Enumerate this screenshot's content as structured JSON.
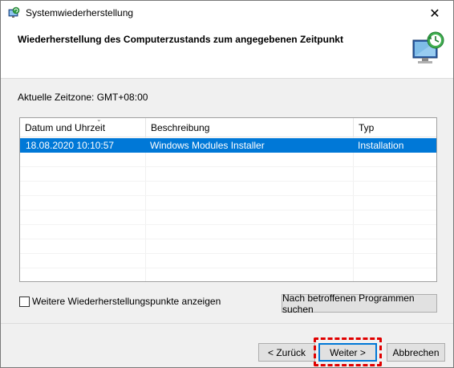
{
  "window": {
    "title": "Systemwiederherstellung",
    "close_glyph": "✕"
  },
  "header": {
    "title": "Wiederherstellung des Computerzustands zum angegebenen Zeitpunkt",
    "icon": "system-restore-monitor-icon"
  },
  "timezone": {
    "label": "Aktuelle Zeitzone: GMT+08:00"
  },
  "restore_list": {
    "columns": [
      "Datum und Uhrzeit",
      "Beschreibung",
      "Typ"
    ],
    "rows": [
      {
        "date": "18.08.2020 10:10:57",
        "description": "Windows Modules Installer",
        "type": "Installation",
        "selected": true
      }
    ]
  },
  "options": {
    "show_more_label": "Weitere Wiederherstellungspunkte anzeigen",
    "show_more_checked": false,
    "scan_programs_label": "Nach betroffenen Programmen suchen"
  },
  "buttons": {
    "back": "< Zurück",
    "next": "Weiter >",
    "cancel": "Abbrechen"
  },
  "colors": {
    "selection": "#0078d7",
    "highlight_border": "#e00000"
  }
}
